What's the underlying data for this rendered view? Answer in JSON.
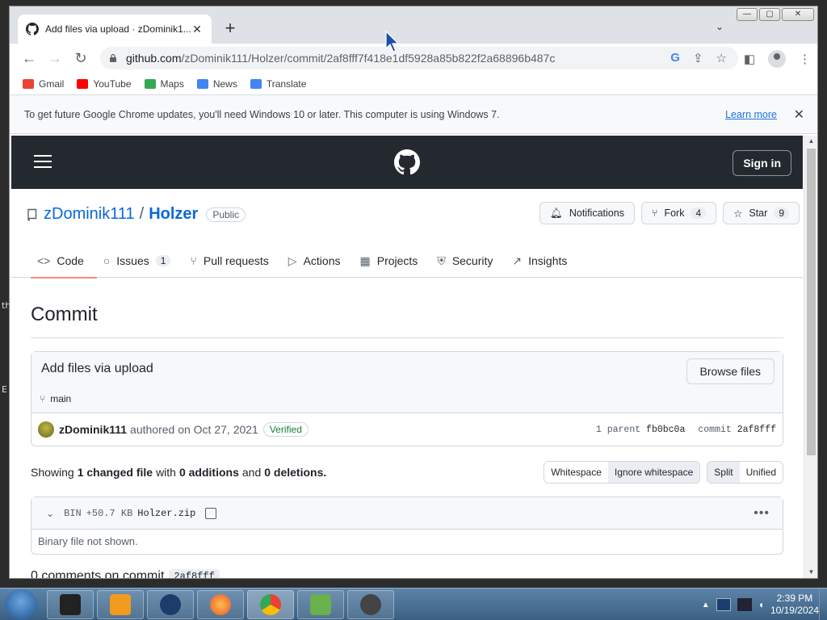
{
  "browser": {
    "tab_title": "Add files via upload · zDominik1...",
    "url_host": "github.com",
    "url_path": "/zDominik111/Holzer/commit/2af8fff7f418e1df5928a85b822f2a68896b487c",
    "bookmarks": [
      {
        "label": "Gmail",
        "icon": "gmail-icon",
        "color": "#ea4335"
      },
      {
        "label": "YouTube",
        "icon": "youtube-icon",
        "color": "#ff0000"
      },
      {
        "label": "Maps",
        "icon": "maps-icon",
        "color": "#34a853"
      },
      {
        "label": "News",
        "icon": "news-icon",
        "color": "#4285f4"
      },
      {
        "label": "Translate",
        "icon": "translate-icon",
        "color": "#4285f4"
      }
    ],
    "infobar_text": "To get future Google Chrome updates, you'll need Windows 10 or later. This computer is using Windows 7.",
    "infobar_link": "Learn more"
  },
  "github": {
    "signin": "Sign in",
    "owner": "zDominik111",
    "separator": "/",
    "repo": "Holzer",
    "visibility": "Public",
    "actions": {
      "notifications": "Notifications",
      "fork": "Fork",
      "fork_count": "4",
      "star": "Star",
      "star_count": "9"
    },
    "nav": [
      {
        "label": "Code",
        "icon": "code-icon",
        "glyph": "<>",
        "active": true
      },
      {
        "label": "Issues",
        "icon": "issue-icon",
        "glyph": "○",
        "count": "1"
      },
      {
        "label": "Pull requests",
        "icon": "pull-request-icon",
        "glyph": "⑂"
      },
      {
        "label": "Actions",
        "icon": "play-icon",
        "glyph": "▷"
      },
      {
        "label": "Projects",
        "icon": "table-icon",
        "glyph": "▦"
      },
      {
        "label": "Security",
        "icon": "shield-icon",
        "glyph": "⛨"
      },
      {
        "label": "Insights",
        "icon": "graph-icon",
        "glyph": "↗"
      }
    ]
  },
  "commit": {
    "heading": "Commit",
    "message": "Add files via upload",
    "browse_files": "Browse files",
    "branch": "main",
    "author": "zDominik111",
    "authored_text": "authored on Oct 27, 2021",
    "verified": "Verified",
    "parent_label": "1 parent",
    "parent_sha": "fb0bc0a",
    "commit_label": "commit",
    "commit_sha": "2af8fff"
  },
  "diff": {
    "showing": "Showing",
    "changed": "1 changed file",
    "with": "with",
    "additions": "0 additions",
    "and": "and",
    "deletions": "0 deletions.",
    "whitespace": "Whitespace",
    "ignore_whitespace": "Ignore whitespace",
    "split": "Split",
    "unified": "Unified",
    "file": {
      "type": "BIN",
      "size": "+50.7 KB",
      "name": "Holzer.zip",
      "body": "Binary file not shown."
    }
  },
  "comments": {
    "text": "0 comments on commit",
    "sha": "2af8fff"
  },
  "taskbar": {
    "time": "2:39 PM",
    "date": "10/19/2024"
  },
  "colors": {
    "gh_header": "#24292f",
    "link": "#0969da",
    "active_tab_underline": "#fd8c73",
    "verified": "#1a7f37"
  }
}
